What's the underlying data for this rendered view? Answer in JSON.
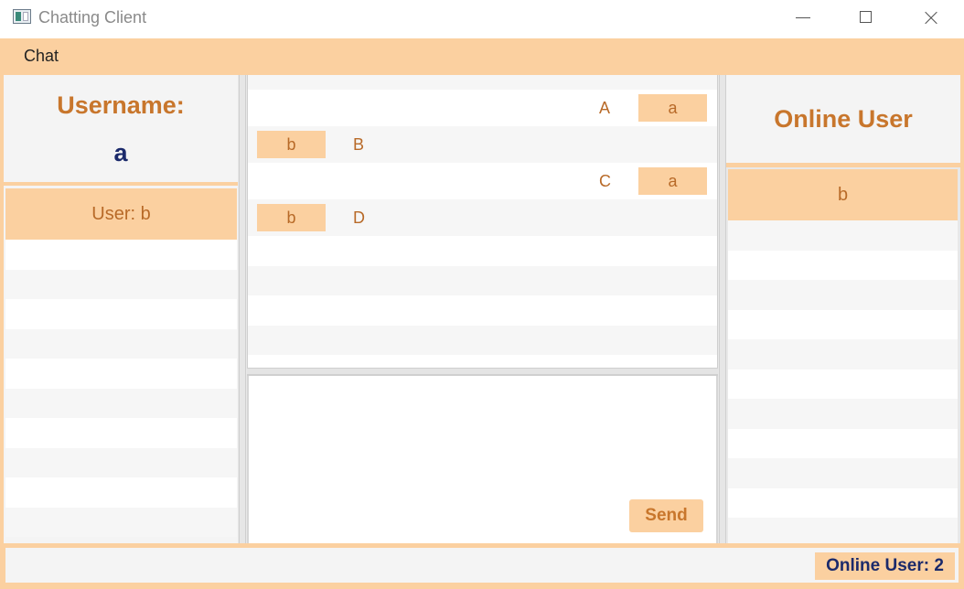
{
  "window": {
    "title": "Chatting Client"
  },
  "menu": {
    "items": [
      "Chat"
    ]
  },
  "left_panel": {
    "username_label": "Username:",
    "username_value": "a",
    "chats": [
      {
        "label": "User: b",
        "selected": true
      }
    ]
  },
  "messages": [
    {
      "sender": "a",
      "text": "A",
      "side": "right"
    },
    {
      "sender": "b",
      "text": "B",
      "side": "left"
    },
    {
      "sender": "a",
      "text": "C",
      "side": "right"
    },
    {
      "sender": "b",
      "text": "D",
      "side": "left"
    }
  ],
  "compose": {
    "send_label": "Send"
  },
  "right_panel": {
    "title": "Online User",
    "users": [
      {
        "name": "b",
        "selected": true
      }
    ]
  },
  "status": {
    "online_count_text": "Online User: 2"
  },
  "colors": {
    "accent": "#fbd0a0",
    "accent_text": "#c8762c",
    "dark_text": "#1b2a6b"
  }
}
